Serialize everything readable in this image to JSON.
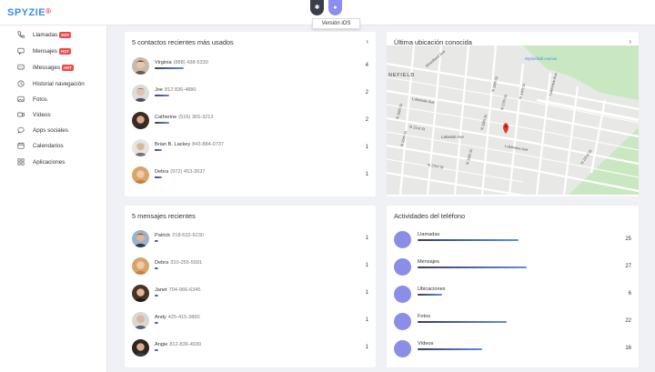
{
  "header": {
    "logo_text": "SPYZIE",
    "logo_mark": "®",
    "tooltip": "Versión iOS",
    "platform_android_icon": "android-icon",
    "platform_ios_icon": "apple-icon"
  },
  "sidebar": {
    "items": [
      {
        "label": "Llamadas",
        "badge": "HOT",
        "icon": "phone-icon"
      },
      {
        "label": "Mensajes",
        "badge": "HOT",
        "icon": "message-icon"
      },
      {
        "label": "iMessages",
        "badge": "HOT",
        "icon": "imessage-icon"
      },
      {
        "label": "Historial navegación",
        "badge": "",
        "icon": "history-icon"
      },
      {
        "label": "Fotos",
        "badge": "",
        "icon": "photo-icon"
      },
      {
        "label": "Vídeos",
        "badge": "",
        "icon": "video-icon"
      },
      {
        "label": "Apps sociales",
        "badge": "",
        "icon": "chat-icon"
      },
      {
        "label": "Calendarios",
        "badge": "",
        "icon": "calendar-icon"
      },
      {
        "label": "Aplicaciones",
        "badge": "",
        "icon": "apps-icon"
      }
    ]
  },
  "contacts_card": {
    "title": "5 contactos recientes más usados",
    "chevron": "›",
    "rows": [
      {
        "name": "Virginia",
        "phone": "(888) 438-5330",
        "count": "4",
        "ratio": 1.0
      },
      {
        "name": "Joe",
        "phone": "812 836-4880",
        "count": "2",
        "ratio": 0.5
      },
      {
        "name": "Catherine",
        "phone": "(516) 365-3213",
        "count": "2",
        "ratio": 0.5
      },
      {
        "name": "Brian B. Lackey",
        "phone": "843-884-0737",
        "count": "1",
        "ratio": 0.25
      },
      {
        "name": "Debra",
        "phone": "(972) 453-3037",
        "count": "1",
        "ratio": 0.25
      }
    ]
  },
  "location_card": {
    "title": "Última ubicación conocida",
    "chevron": "›",
    "map_labels": {
      "park": "Wyckefield Avenue",
      "area": "NEFIELD",
      "a1": "Woodland Ave",
      "a2": "Lakeside Ave",
      "a3": "N 16th St",
      "a4": "N 15th St",
      "a5": "N 14th St",
      "a6": "Lakeside Ave",
      "a7": "N 21st St",
      "a8": "Lakeview Ave",
      "a9": "N 19th St",
      "a10": "N 18th St",
      "a11": "N 17th St",
      "a12": "N 20th St",
      "a13": "N 22nd St",
      "a14": "N 23rd St",
      "a15": "Lakeview Ave"
    }
  },
  "messages_card": {
    "title": "5 mensajes recientes",
    "rows": [
      {
        "name": "Patrick",
        "phone": "218-632-6230",
        "count": "1"
      },
      {
        "name": "Debra",
        "phone": "310-255-5591",
        "count": "1"
      },
      {
        "name": "Janet",
        "phone": "704-966-6345",
        "count": "1"
      },
      {
        "name": "Andy",
        "phone": "425-415-3860",
        "count": "1"
      },
      {
        "name": "Angie",
        "phone": "812-836-4030",
        "count": "1"
      }
    ]
  },
  "activity_card": {
    "title": "Actividades del teléfono",
    "rows": [
      {
        "label": "Llamadas",
        "count": "25",
        "ratio": 0.926
      },
      {
        "label": "Mensajes",
        "count": "27",
        "ratio": 1.0
      },
      {
        "label": "Ubicaciones",
        "count": "6",
        "ratio": 0.222
      },
      {
        "label": "Fotos",
        "count": "22",
        "ratio": 0.815
      },
      {
        "label": "Vídeos",
        "count": "16",
        "ratio": 0.593
      }
    ]
  },
  "colors": {
    "accent": "#5c8de8",
    "activity_dot": "#8a8ee6",
    "badge": "#f04848",
    "map_pin": "#e23a2e",
    "park": "#c9e8c2"
  }
}
